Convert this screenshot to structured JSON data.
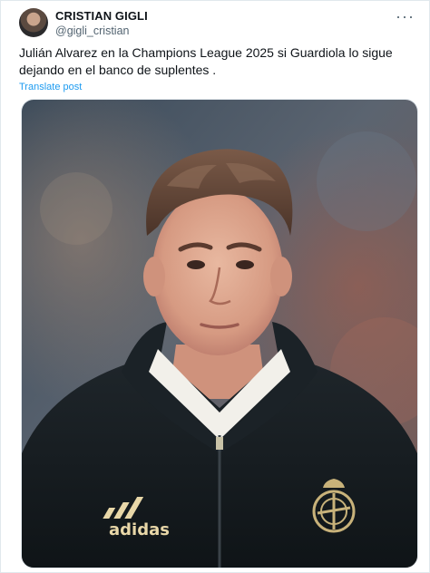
{
  "author": {
    "name": "CRISTIAN GIGLI",
    "handle": "@gigli_cristian"
  },
  "tweet": {
    "text": "Julián Alvarez en la Champions League 2025 si Guardiola lo sigue dejando en el banco de suplentes .",
    "translate_label": "Translate post"
  },
  "media": {
    "jacket_brand": "adidas"
  },
  "icons": {
    "more": "more-horizontal-icon"
  },
  "colors": {
    "link": "#1d9bf0",
    "text": "#0f1419",
    "secondary": "#536471",
    "jacket": "#141a1e",
    "crest_gold": "#c8b27a"
  }
}
